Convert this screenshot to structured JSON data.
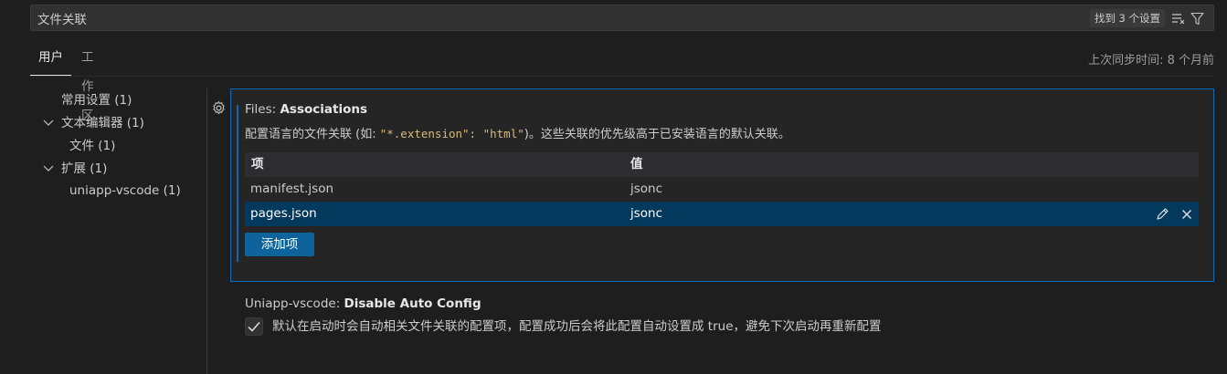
{
  "search": {
    "value": "文件关联",
    "result_count": "找到 3 个设置"
  },
  "tabs": [
    {
      "label": "用户",
      "active": true
    },
    {
      "label": "工作区",
      "active": false
    }
  ],
  "sync_status": "上次同步时间: 8 个月前",
  "toc": {
    "items": [
      {
        "label": "常用设置 (1)"
      },
      {
        "label": "文本编辑器 (1)",
        "expanded": true
      },
      {
        "label": "文件 (1)"
      },
      {
        "label": "扩展 (1)",
        "expanded": true
      },
      {
        "label": "uniapp-vscode (1)"
      }
    ]
  },
  "file_assoc": {
    "title_prefix": "Files: ",
    "title_name": "Associations",
    "desc_prefix": "配置语言的文件关联 (如: ",
    "desc_code1": "\"*.extension\": \"html\"",
    "desc_suffix": ")。这些关联的优先级高于已安装语言的默认关联。",
    "headers": {
      "key": "项",
      "value": "值"
    },
    "rows": [
      {
        "key": "manifest.json",
        "value": "jsonc",
        "selected": false
      },
      {
        "key": "pages.json",
        "value": "jsonc",
        "selected": true
      }
    ],
    "add_button": "添加项"
  },
  "auto_config": {
    "title_prefix": "Uniapp-vscode: ",
    "title_name": "Disable Auto Config",
    "checked": true,
    "description": "默认在启动时会自动相关文件关联的配置项，配置成功后会将此配置自动设置成 true，避免下次启动再重新配置"
  },
  "colors": {
    "background": "#1e1e1e",
    "accent": "#0a6ab8",
    "selected_row": "#04395e",
    "button": "#0e639c"
  }
}
